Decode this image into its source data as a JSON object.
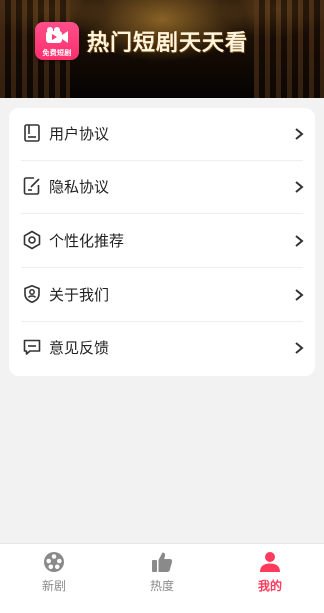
{
  "header": {
    "logo_text": "免费短剧",
    "title": "热门短剧天天看"
  },
  "menu": {
    "items": [
      {
        "label": "用户协议",
        "icon": "document-icon"
      },
      {
        "label": "隐私协议",
        "icon": "edit-document-icon"
      },
      {
        "label": "个性化推荐",
        "icon": "gear-icon"
      },
      {
        "label": "关于我们",
        "icon": "user-shield-icon"
      },
      {
        "label": "意见反馈",
        "icon": "message-icon"
      }
    ]
  },
  "tabbar": {
    "tabs": [
      {
        "label": "新剧",
        "icon": "film-reel-icon",
        "active": false
      },
      {
        "label": "热度",
        "icon": "thumbs-up-icon",
        "active": false
      },
      {
        "label": "我的",
        "icon": "person-icon",
        "active": true
      }
    ]
  },
  "colors": {
    "accent": "#ff3a5c",
    "logo": "#ff2f6d",
    "icon": "#333333",
    "inactive_tab": "#8a8a8a",
    "background": "#f2f2f2"
  }
}
